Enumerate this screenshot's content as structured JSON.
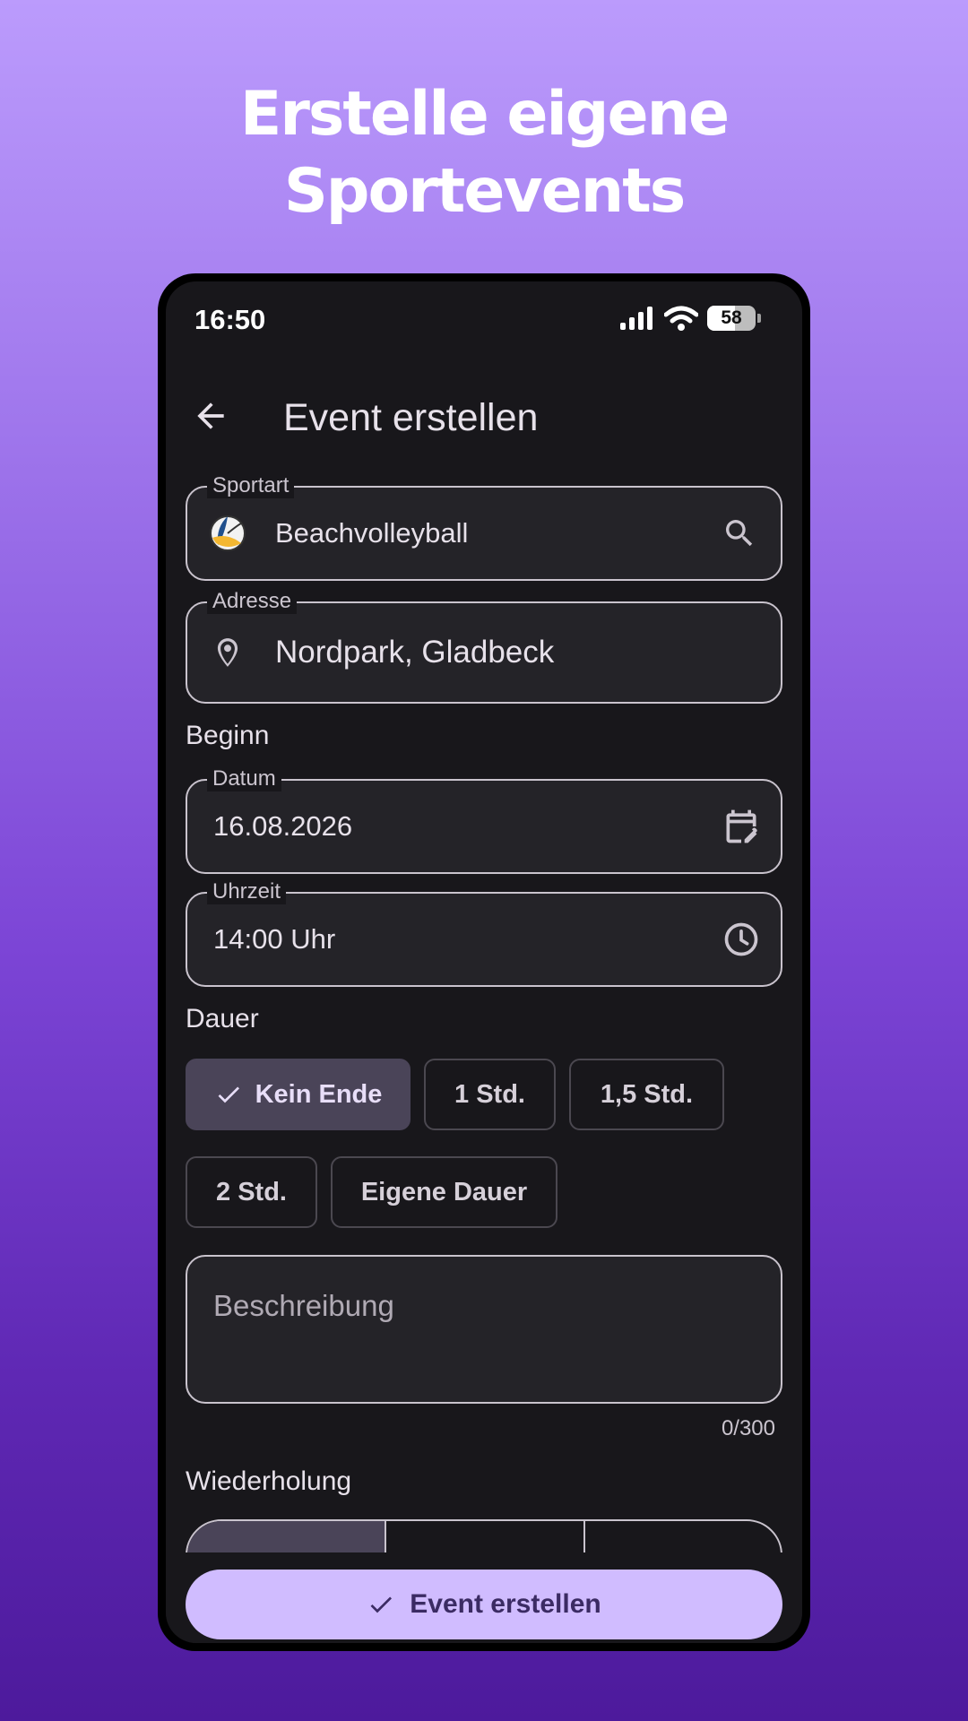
{
  "headline": {
    "line1": "Erstelle eigene",
    "line2": "Sportevents"
  },
  "status_bar": {
    "time": "16:50",
    "battery": "58"
  },
  "appbar": {
    "title": "Event erstellen",
    "back_icon": "arrow-back-icon"
  },
  "fields": {
    "sport": {
      "label": "Sportart",
      "value": "Beachvolleyball",
      "icon": "volleyball-icon",
      "trailing_icon": "search-icon"
    },
    "address": {
      "label": "Adresse",
      "value": "Nordpark, Gladbeck",
      "icon": "location-pin-icon"
    },
    "date": {
      "label": "Datum",
      "value": "16.08.2026",
      "icon": "calendar-edit-icon"
    },
    "time": {
      "label": "Uhrzeit",
      "value": "14:00 Uhr",
      "icon": "clock-icon"
    }
  },
  "sections": {
    "start": "Beginn",
    "duration": "Dauer",
    "repeat": "Wiederholung"
  },
  "duration_chips": [
    {
      "label": "Kein Ende",
      "selected": true
    },
    {
      "label": "1 Std.",
      "selected": false
    },
    {
      "label": "1,5 Std.",
      "selected": false
    },
    {
      "label": "2 Std.",
      "selected": false
    },
    {
      "label": "Eigene Dauer",
      "selected": false
    }
  ],
  "description": {
    "placeholder": "Beschreibung",
    "counter": "0/300"
  },
  "create_button": {
    "label": "Event erstellen"
  },
  "colors": {
    "accent": "#d0bcff",
    "background": "#18171b",
    "chip_selected": "#4a4458"
  }
}
